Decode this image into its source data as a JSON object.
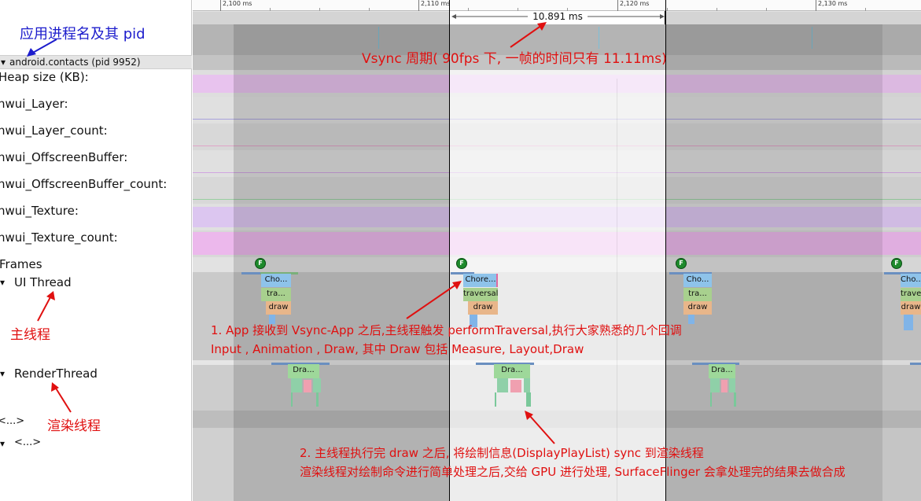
{
  "timeline": {
    "ticks": [
      "2,100 ms",
      "2,110 ms",
      "2,120 ms",
      "2,130 ms"
    ],
    "selection_label": "10.891 ms"
  },
  "tracks": {
    "process_label": "android.contacts (pid 9952)",
    "heap": "Heap size (KB):",
    "layer": "hwui_Layer:",
    "layer_count": "hwui_Layer_count:",
    "offscreen": "hwui_OffscreenBuffer:",
    "offscreen_count": "hwui_OffscreenBuffer_count:",
    "texture": "hwui_Texture:",
    "texture_count": "hwui_Texture_count:",
    "frames": "Frames",
    "ui_thread": "UI Thread",
    "render_thread": "RenderThread",
    "more1": "<...>",
    "more2": "<...>",
    "expand_glyph": "▾"
  },
  "slices": {
    "choreographer_a": "Cho...",
    "choreographer_b": "Chore...",
    "choreographer_d": "Cho...",
    "traversal_a": "tra...",
    "traversal_b": "traversal",
    "traversal_d": "travers",
    "draw": "draw",
    "draw_frame": "Dra...",
    "frame_marker": "F"
  },
  "annotations": {
    "pid_note": "应用进程名及其 pid",
    "vsync_note": "Vsync 周期( 90fps 下, 一帧的时间只有 11.11ms)",
    "main_thread": "主线程",
    "render_thread": "渲染线程",
    "step1_line1": "1. App 接收到 Vsync-App 之后,主线程触发 performTraversal,执行大家熟悉的几个回调",
    "step1_line2": "Input , Animation , Draw, 其中 Draw 包括 Measure, Layout,Draw",
    "step2_line1": "2. 主线程执行完 draw 之后, 将绘制信息(DisplayPlayList) sync 到渲染线程",
    "step2_line2": "渲染线程对绘制命令进行简单处理之后,交给 GPU 进行处理, SurfaceFlinger 会拿处理完的结果去做合成"
  },
  "colors": {
    "annotation_red": "#e01010",
    "annotation_blue": "#1c1ccc",
    "heap_track": "#e8c3ee",
    "texture_track": "#dcc6f0",
    "texture_count_track": "#ecb8ec",
    "choreographer_slice": "#8ec3ea",
    "traversal_slice": "#a8d08e",
    "draw_slice": "#e8b68a",
    "drawframe_slice": "#9ed89a"
  }
}
